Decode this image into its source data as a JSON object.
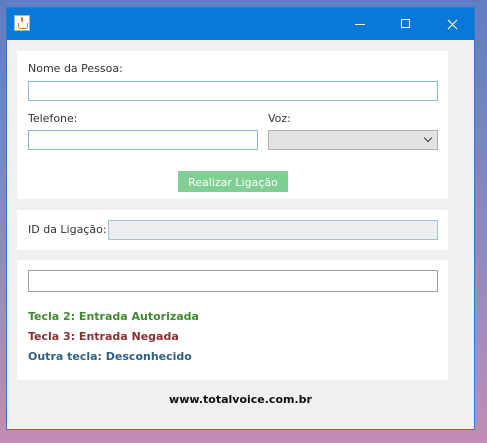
{
  "titlebar": {
    "app_icon": "java-cup-icon",
    "controls": {
      "minimize": "minimize-icon",
      "maximize": "maximize-icon",
      "close": "close-icon"
    }
  },
  "form": {
    "nome_label": "Nome da Pessoa:",
    "nome_value": "",
    "telefone_label": "Telefone:",
    "telefone_value": "",
    "voz_label": "Voz:",
    "voz_value": "",
    "call_button_label": "Realizar Ligação",
    "call_button_color": "#7fcf92"
  },
  "call": {
    "id_label": "ID da Ligação:",
    "id_value": ""
  },
  "result": {
    "input_value": "",
    "status": [
      {
        "text": "Tecla 2: Entrada Autorizada",
        "color": "#3f8a2e"
      },
      {
        "text": "Tecla 3: Entrada Negada",
        "color": "#8b2e2e"
      },
      {
        "text": "Outra tecla: Desconhecido",
        "color": "#2f5f8a"
      }
    ]
  },
  "footer": {
    "text": "www.totalvoice.com.br"
  }
}
